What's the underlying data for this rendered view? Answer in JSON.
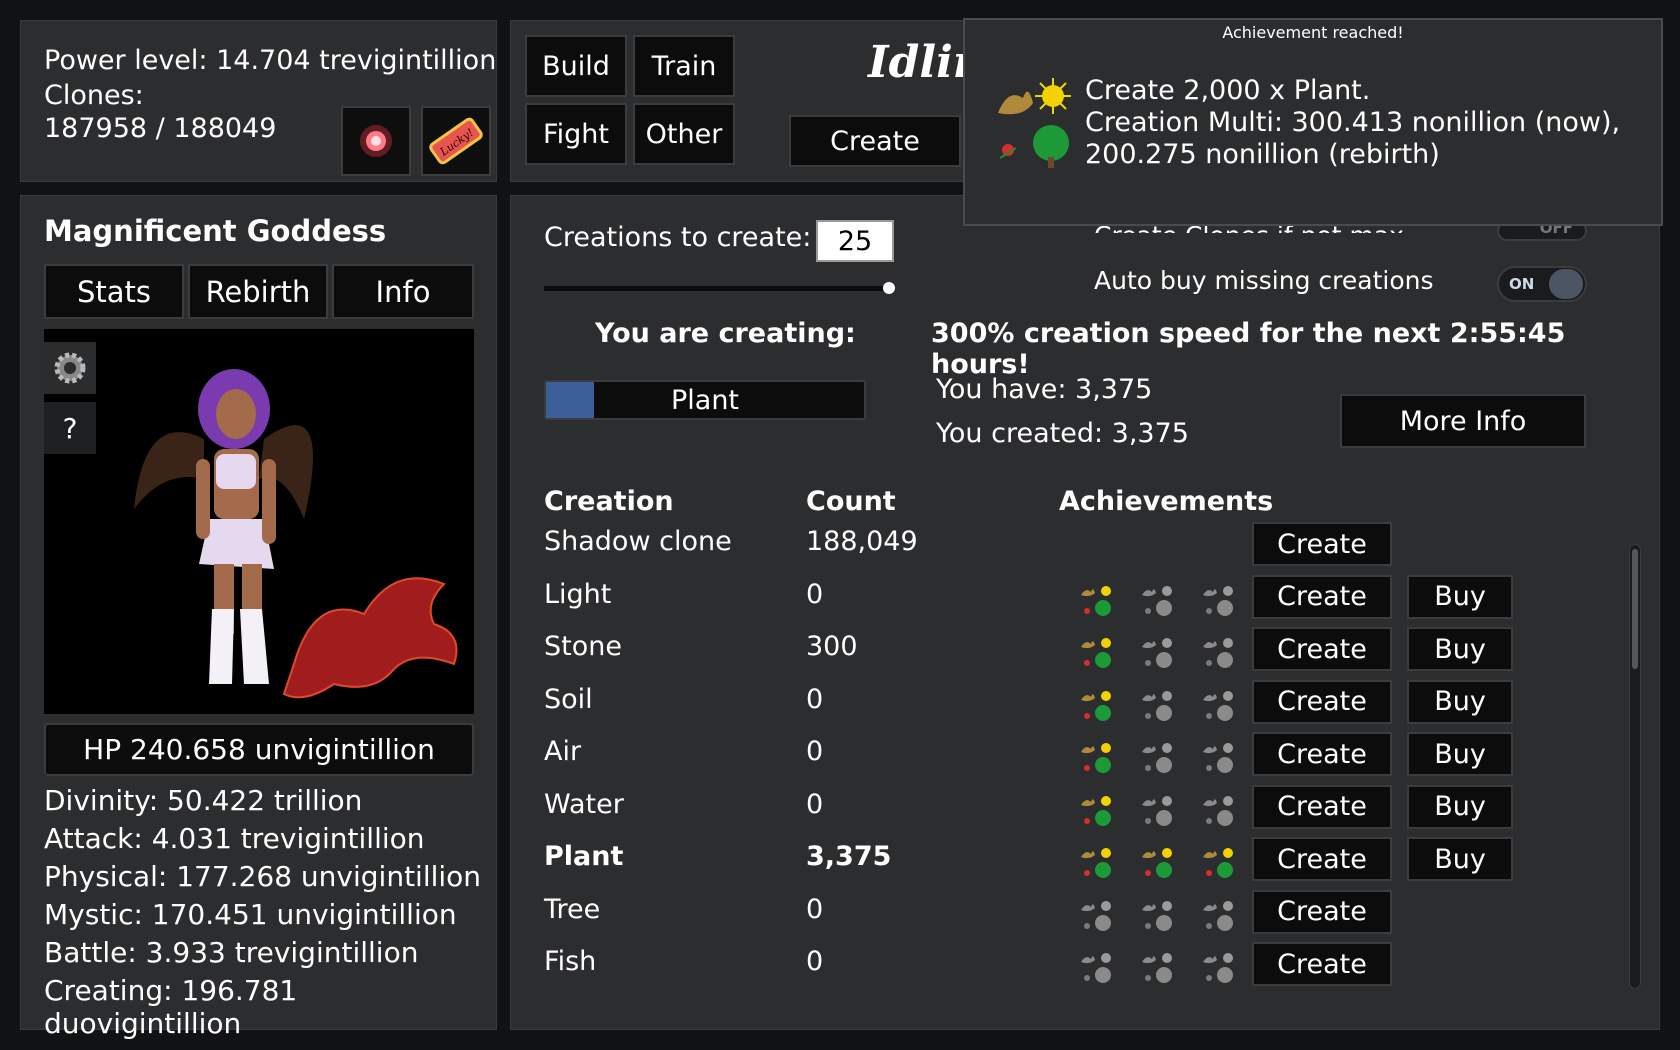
{
  "player": {
    "power_level": "Power level: 14.704 trevigintillion",
    "clones_label": "Clones:",
    "clones_value": "187958 / 188049",
    "lucky_text": "Lucky!"
  },
  "nav": {
    "build": "Build",
    "train": "Train",
    "fight": "Fight",
    "other": "Other",
    "create": "Create",
    "logo_text": "Idlin"
  },
  "popup": {
    "title": "Achievement reached!",
    "line1": "Create 2,000 x Plant.",
    "line2": "Creation Multi: 300.413 nonillion (now),",
    "line3": "200.275 nonillion (rebirth)"
  },
  "character": {
    "name": "Magnificent Goddess",
    "tabs": [
      "Stats",
      "Rebirth",
      "Info"
    ],
    "help": "?",
    "hp": "HP 240.658 unvigintillion",
    "stats": [
      "Divinity: 50.422 trillion",
      "Attack: 4.031 trevigintillion",
      "Physical: 177.268 unvigintillion",
      "Mystic: 170.451 unvigintillion",
      "Battle: 3.933 trevigintillion",
      "Creating: 196.781 duovigintillion"
    ]
  },
  "creation": {
    "to_create_label": "Creations to create:",
    "to_create_value": "25",
    "slider_fraction": 1.0,
    "you_are_creating": "You are creating:",
    "current": "Plant",
    "progress_fraction": 0.15,
    "speed_text": "300% creation speed for the next 2:55:45 hours!",
    "you_have": "You have: 3,375",
    "you_created": "You created: 3,375",
    "more_info": "More Info",
    "option_clones": "Create Clones if not max",
    "option_clones_state": "OFF",
    "option_auto_buy": "Auto buy missing creations",
    "option_auto_buy_state": "ON"
  },
  "table": {
    "headers": {
      "creation": "Creation",
      "count": "Count",
      "achievements": "Achievements"
    },
    "create_label": "Create",
    "buy_label": "Buy",
    "rows": [
      {
        "name": "Shadow clone",
        "count": "188,049",
        "ach": [],
        "buy": false,
        "bold": false
      },
      {
        "name": "Light",
        "count": "0",
        "ach": [
          1,
          0,
          0
        ],
        "buy": true,
        "bold": false
      },
      {
        "name": "Stone",
        "count": "300",
        "ach": [
          1,
          0,
          0
        ],
        "buy": true,
        "bold": false
      },
      {
        "name": "Soil",
        "count": "0",
        "ach": [
          1,
          0,
          0
        ],
        "buy": true,
        "bold": false
      },
      {
        "name": "Air",
        "count": "0",
        "ach": [
          1,
          0,
          0
        ],
        "buy": true,
        "bold": false
      },
      {
        "name": "Water",
        "count": "0",
        "ach": [
          1,
          0,
          0
        ],
        "buy": true,
        "bold": false
      },
      {
        "name": "Plant",
        "count": "3,375",
        "ach": [
          1,
          1,
          1
        ],
        "buy": true,
        "bold": true
      },
      {
        "name": "Tree",
        "count": "0",
        "ach": [
          0,
          0,
          0
        ],
        "buy": false,
        "bold": false
      },
      {
        "name": "Fish",
        "count": "0",
        "ach": [
          0,
          0,
          0
        ],
        "buy": false,
        "bold": false
      }
    ]
  },
  "colors": {
    "panel": "#2c2d2f",
    "button": "#0c0c0d",
    "progress": "#3b5f98",
    "achievement_gold": "#f2d200",
    "achievement_green": "#1b9a37"
  }
}
